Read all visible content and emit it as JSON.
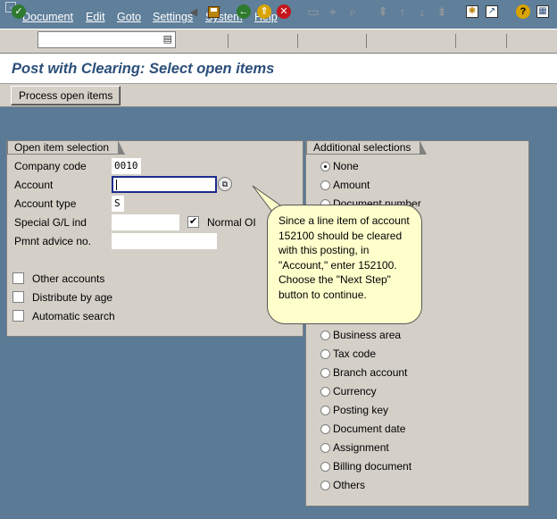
{
  "menubar": {
    "items": [
      "Document",
      "Edit",
      "Goto",
      "Settings",
      "System",
      "Help"
    ]
  },
  "toolbar": {
    "command_value": ""
  },
  "title": "Post with Clearing: Select open items",
  "app_toolbar": {
    "process_button": "Process open items"
  },
  "open_item_selection": {
    "title": "Open item selection",
    "fields": {
      "company_code": {
        "label": "Company code",
        "value": "0010"
      },
      "account": {
        "label": "Account",
        "value": ""
      },
      "account_type": {
        "label": "Account type",
        "value": "S"
      },
      "special_gl": {
        "label": "Special G/L ind",
        "value": ""
      },
      "normal_oi": {
        "label": "Normal OI",
        "checked": true
      },
      "pmnt_advice": {
        "label": "Pmnt advice no.",
        "value": ""
      }
    },
    "checkboxes": [
      "Other accounts",
      "Distribute by age",
      "Automatic search"
    ]
  },
  "additional_selections": {
    "title": "Additional selections",
    "options": [
      "None",
      "Amount",
      "Document number",
      "Business area",
      "Tax code",
      "Branch account",
      "Currency",
      "Posting key",
      "Document date",
      "Assignment",
      "Billing document",
      "Others"
    ],
    "selected": "None"
  },
  "callout": {
    "text": "Since a line item of account 152100 should be cleared with this posting, in \"Account,\" enter 152100. Choose the \"Next Step\" button to continue."
  },
  "colors": {
    "title": "#2b4f7a",
    "background": "#5a7a96",
    "panel": "#d4d0c8",
    "callout": "#ffffcc"
  }
}
